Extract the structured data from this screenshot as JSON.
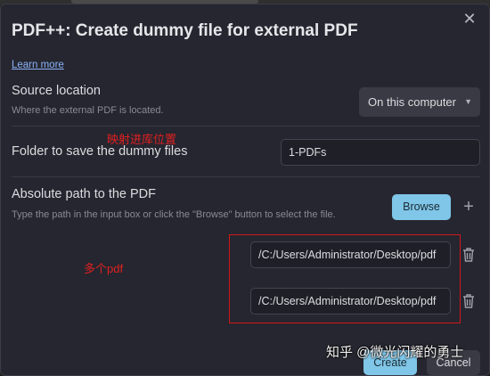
{
  "dialog": {
    "title": "PDF++: Create dummy file for external PDF",
    "learn_more": "Learn more"
  },
  "source_location": {
    "name": "Source location",
    "description": "Where the external PDF is located.",
    "selected": "On this computer"
  },
  "folder": {
    "name": "Folder to save the dummy files",
    "value": "1-PDFs"
  },
  "absolute_path": {
    "name": "Absolute path to the PDF",
    "description": "Type the path in the input box or click the \"Browse\" button to select the file.",
    "browse_label": "Browse",
    "paths": [
      "/C:/Users/Administrator/Desktop/pdf",
      "/C:/Users/Administrator/Desktop/pdf"
    ]
  },
  "footer": {
    "submit_label": "Create",
    "cancel_label": "Cancel"
  },
  "annotations": {
    "folder_note": "映射进库位置",
    "multi_pdf_note": "多个pdf"
  },
  "watermark": "知乎 @微光闪耀的勇士",
  "colors": {
    "accent": "#7fc6e8",
    "modal_bg": "#262630",
    "annotation": "#e02020"
  },
  "icons": [
    "close-icon",
    "caret-down-icon",
    "plus-icon",
    "trash-icon"
  ]
}
